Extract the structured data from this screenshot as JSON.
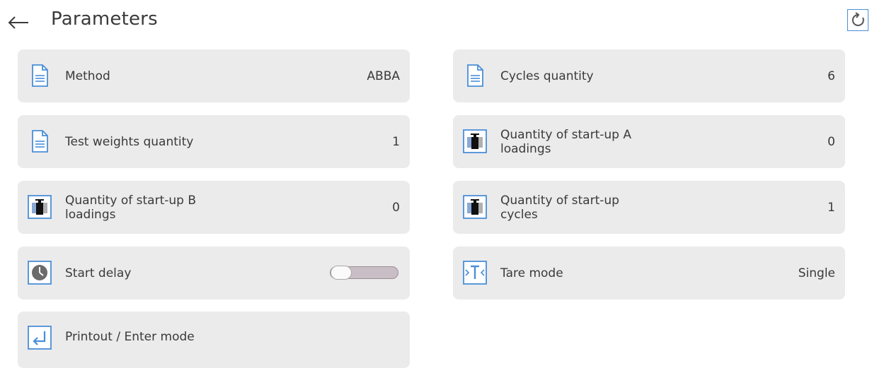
{
  "header": {
    "title": "Parameters",
    "back_icon": "arrow-left-icon",
    "refresh_icon": "refresh-icon"
  },
  "accent_color": "#4a8ed8",
  "tiles": [
    {
      "label": "Method",
      "value": "ABBA",
      "icon": "document-icon"
    },
    {
      "label": "Cycles quantity",
      "value": "6",
      "icon": "document-icon"
    },
    {
      "label": "Test weights quantity",
      "value": "1",
      "icon": "document-icon"
    },
    {
      "label": "Quantity of start-up A loadings",
      "value": "0",
      "icon": "weight-loading-icon"
    },
    {
      "label": "Quantity of start-up B loadings",
      "value": "0",
      "icon": "weight-loading-icon"
    },
    {
      "label": "Quantity of start-up cycles",
      "value": "1",
      "icon": "weight-loading-icon"
    },
    {
      "label": "Start delay",
      "toggle_on": false,
      "icon": "clock-icon"
    },
    {
      "label": "Tare mode",
      "value": "Single",
      "icon": "tare-icon"
    },
    {
      "label": "Printout / Enter mode",
      "icon": "enter-icon"
    }
  ]
}
